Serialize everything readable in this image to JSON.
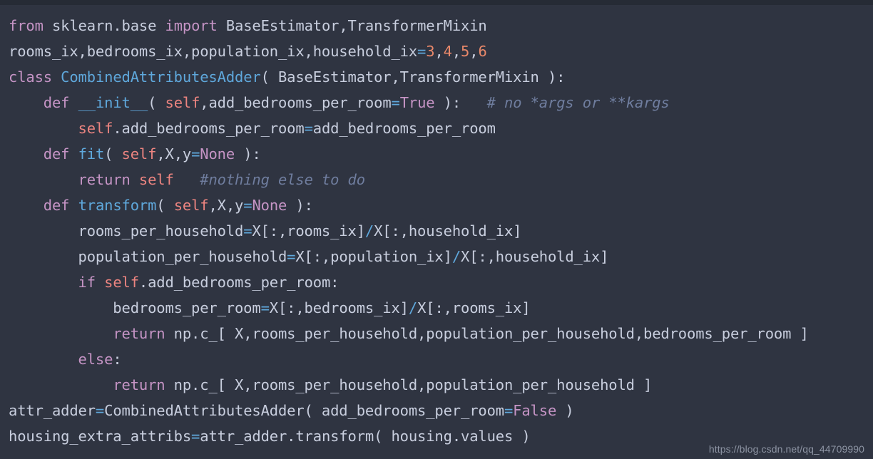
{
  "editor": {
    "background_color": "#2f3441",
    "topbar_color": "#262b35",
    "language": "python"
  },
  "theme": {
    "keyword": "#c594c5",
    "function": "#5fa8dc",
    "self": "#ec8480",
    "number": "#e8886a",
    "constant": "#c594c5",
    "operator": "#5fa8dc",
    "text": "#c8cede",
    "comment": "#6f7d9e"
  },
  "watermark": {
    "text": "https://blog.csdn.net/qq_44709990"
  },
  "code": {
    "lines": [
      "from sklearn.base import BaseEstimator,TransformerMixin",
      "rooms_ix,bedrooms_ix,population_ix,household_ix=3,4,5,6",
      "class CombinedAttributesAdder( BaseEstimator,TransformerMixin ):",
      "    def __init__( self,add_bedrooms_per_room=True ):   # no *args or **kargs",
      "        self.add_bedrooms_per_room=add_bedrooms_per_room",
      "    def fit( self,X,y=None ):",
      "        return self   #nothing else to do",
      "    def transform( self,X,y=None ):",
      "        rooms_per_household=X[:,rooms_ix]/X[:,household_ix]",
      "        population_per_household=X[:,population_ix]/X[:,household_ix]",
      "        if self.add_bedrooms_per_room:",
      "            bedrooms_per_room=X[:,bedrooms_ix]/X[:,rooms_ix]",
      "            return np.c_[ X,rooms_per_household,population_per_household,bedrooms_per_room ]",
      "        else:",
      "            return np.c_[ X,rooms_per_household,population_per_household ]",
      "attr_adder=CombinedAttributesAdder( add_bedrooms_per_room=False )",
      "housing_extra_attribs=attr_adder.transform( housing.values )"
    ],
    "tokens": [
      [
        [
          "from",
          "kw"
        ],
        [
          " ",
          "pun"
        ],
        [
          "sklearn.base",
          "txt"
        ],
        [
          " ",
          "pun"
        ],
        [
          "import",
          "kw"
        ],
        [
          " ",
          "pun"
        ],
        [
          "BaseEstimator,TransformerMixin",
          "txt"
        ]
      ],
      [
        [
          "rooms_ix,bedrooms_ix,population_ix,household_ix",
          "txt"
        ],
        [
          "=",
          "op"
        ],
        [
          "3",
          "num"
        ],
        [
          ",",
          "pun"
        ],
        [
          "4",
          "num"
        ],
        [
          ",",
          "pun"
        ],
        [
          "5",
          "num"
        ],
        [
          ",",
          "pun"
        ],
        [
          "6",
          "num"
        ]
      ],
      [
        [
          "class",
          "kw"
        ],
        [
          " ",
          "pun"
        ],
        [
          "CombinedAttributesAdder",
          "fn"
        ],
        [
          "( ",
          "pun"
        ],
        [
          "BaseEstimator,TransformerMixin",
          "txt"
        ],
        [
          " ):",
          "pun"
        ]
      ],
      [
        [
          "    ",
          "pun"
        ],
        [
          "def",
          "kw"
        ],
        [
          " ",
          "pun"
        ],
        [
          "__init__",
          "fn"
        ],
        [
          "( ",
          "pun"
        ],
        [
          "self",
          "self"
        ],
        [
          ",add_bedrooms_per_room",
          "txt"
        ],
        [
          "=",
          "op"
        ],
        [
          "True",
          "const"
        ],
        [
          " ):",
          "pun"
        ],
        [
          "   ",
          "pun"
        ],
        [
          "# no *args or **kargs",
          "cmt"
        ]
      ],
      [
        [
          "        ",
          "pun"
        ],
        [
          "self",
          "self"
        ],
        [
          ".add_bedrooms_per_room",
          "txt"
        ],
        [
          "=",
          "op"
        ],
        [
          "add_bedrooms_per_room",
          "txt"
        ]
      ],
      [
        [
          "    ",
          "pun"
        ],
        [
          "def",
          "kw"
        ],
        [
          " ",
          "pun"
        ],
        [
          "fit",
          "fn"
        ],
        [
          "( ",
          "pun"
        ],
        [
          "self",
          "self"
        ],
        [
          ",X,y",
          "txt"
        ],
        [
          "=",
          "op"
        ],
        [
          "None",
          "const"
        ],
        [
          " ):",
          "pun"
        ]
      ],
      [
        [
          "        ",
          "pun"
        ],
        [
          "return",
          "kw"
        ],
        [
          " ",
          "pun"
        ],
        [
          "self",
          "self"
        ],
        [
          "   ",
          "pun"
        ],
        [
          "#nothing else to do",
          "cmt"
        ]
      ],
      [
        [
          "    ",
          "pun"
        ],
        [
          "def",
          "kw"
        ],
        [
          " ",
          "pun"
        ],
        [
          "transform",
          "fn"
        ],
        [
          "( ",
          "pun"
        ],
        [
          "self",
          "self"
        ],
        [
          ",X,y",
          "txt"
        ],
        [
          "=",
          "op"
        ],
        [
          "None",
          "const"
        ],
        [
          " ):",
          "pun"
        ]
      ],
      [
        [
          "        rooms_per_household",
          "txt"
        ],
        [
          "=",
          "op"
        ],
        [
          "X[:,rooms_ix]",
          "txt"
        ],
        [
          "/",
          "op"
        ],
        [
          "X[:,household_ix]",
          "txt"
        ]
      ],
      [
        [
          "        population_per_household",
          "txt"
        ],
        [
          "=",
          "op"
        ],
        [
          "X[:,population_ix]",
          "txt"
        ],
        [
          "/",
          "op"
        ],
        [
          "X[:,household_ix]",
          "txt"
        ]
      ],
      [
        [
          "        ",
          "pun"
        ],
        [
          "if",
          "kw"
        ],
        [
          " ",
          "pun"
        ],
        [
          "self",
          "self"
        ],
        [
          ".add_bedrooms_per_room:",
          "txt"
        ]
      ],
      [
        [
          "            bedrooms_per_room",
          "txt"
        ],
        [
          "=",
          "op"
        ],
        [
          "X[:,bedrooms_ix]",
          "txt"
        ],
        [
          "/",
          "op"
        ],
        [
          "X[:,rooms_ix]",
          "txt"
        ]
      ],
      [
        [
          "            ",
          "pun"
        ],
        [
          "return",
          "kw"
        ],
        [
          " ",
          "pun"
        ],
        [
          "np.c_[ X,rooms_per_household,population_per_household,bedrooms_per_room ]",
          "txt"
        ]
      ],
      [
        [
          "        ",
          "pun"
        ],
        [
          "else",
          "kw"
        ],
        [
          ":",
          "pun"
        ]
      ],
      [
        [
          "            ",
          "pun"
        ],
        [
          "return",
          "kw"
        ],
        [
          " ",
          "pun"
        ],
        [
          "np.c_[ X,rooms_per_household,population_per_household ]",
          "txt"
        ]
      ],
      [
        [
          "attr_adder",
          "txt"
        ],
        [
          "=",
          "op"
        ],
        [
          "CombinedAttributesAdder( add_bedrooms_per_room",
          "txt"
        ],
        [
          "=",
          "op"
        ],
        [
          "False",
          "const"
        ],
        [
          " )",
          "pun"
        ]
      ],
      [
        [
          "housing_extra_attribs",
          "txt"
        ],
        [
          "=",
          "op"
        ],
        [
          "attr_adder.transform( housing.values )",
          "txt"
        ]
      ]
    ]
  }
}
